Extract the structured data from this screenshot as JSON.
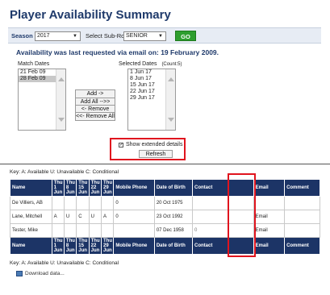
{
  "page": {
    "title": "Player Availability Summary"
  },
  "filter_bar": {
    "season_label": "Season",
    "season_value": "2017",
    "subrole_label": "Select Sub-Role",
    "subrole_value": "SENIOR",
    "go_label": "GO"
  },
  "availability_message": "Availability was last requested via email on: 19 February 2009.",
  "match_dates": {
    "label": "Match Dates",
    "options": [
      "21 Feb 09",
      "28 Feb 09"
    ],
    "selected_index": 1
  },
  "selected_dates": {
    "label": "Selected Dates",
    "count_label": "(Count:5)",
    "options": [
      "1 Jun 17",
      "8 Jun 17",
      "15 Jun 17",
      "22 Jun 17",
      "29 Jun 17"
    ]
  },
  "buttons": {
    "add": "Add ->",
    "add_all": "Add All -->>",
    "remove": "<- Remove",
    "remove_all": "<<- Remove All",
    "refresh": "Refresh"
  },
  "extended_details": {
    "label": "Show extended details",
    "checked": true
  },
  "key_text": "Key: A: Available U: Unavailable C: Conditional",
  "table": {
    "headers": [
      "Name",
      "Thu 1 Jun",
      "Thu 8 Jun",
      "Thu 15 Jun",
      "Thu 22 Jun",
      "Thu 29 Jun",
      "Mobile Phone",
      "Date of Birth",
      "Contact",
      "",
      "Email",
      "Comment"
    ],
    "rows": [
      {
        "name": "De Villiers, AB",
        "days": [
          "",
          "",
          "",
          "",
          ""
        ],
        "phone": "0",
        "dob": "20 Oct 1975",
        "contact": "",
        "email": "",
        "comment": ""
      },
      {
        "name": "Lane, Mitchell",
        "days": [
          "A",
          "U",
          "C",
          "U",
          "A"
        ],
        "phone": "0",
        "dob": "23 Oct 1992",
        "contact": "",
        "email": "Email",
        "comment": ""
      },
      {
        "name": "Tester, Mike",
        "days": [
          "",
          "",
          "",
          "",
          ""
        ],
        "phone": "",
        "dob": "07 Dec 1958",
        "contact": "0",
        "email": "Email",
        "comment": ""
      }
    ]
  },
  "download_label": "Download data...",
  "colors": {
    "header_navy": "#1c3466",
    "available": "#66cc55",
    "unavailable": "#e8262a",
    "conditional": "#f1dd2a",
    "highlight_red": "#e0141e",
    "go_green": "#2e9e2e"
  }
}
